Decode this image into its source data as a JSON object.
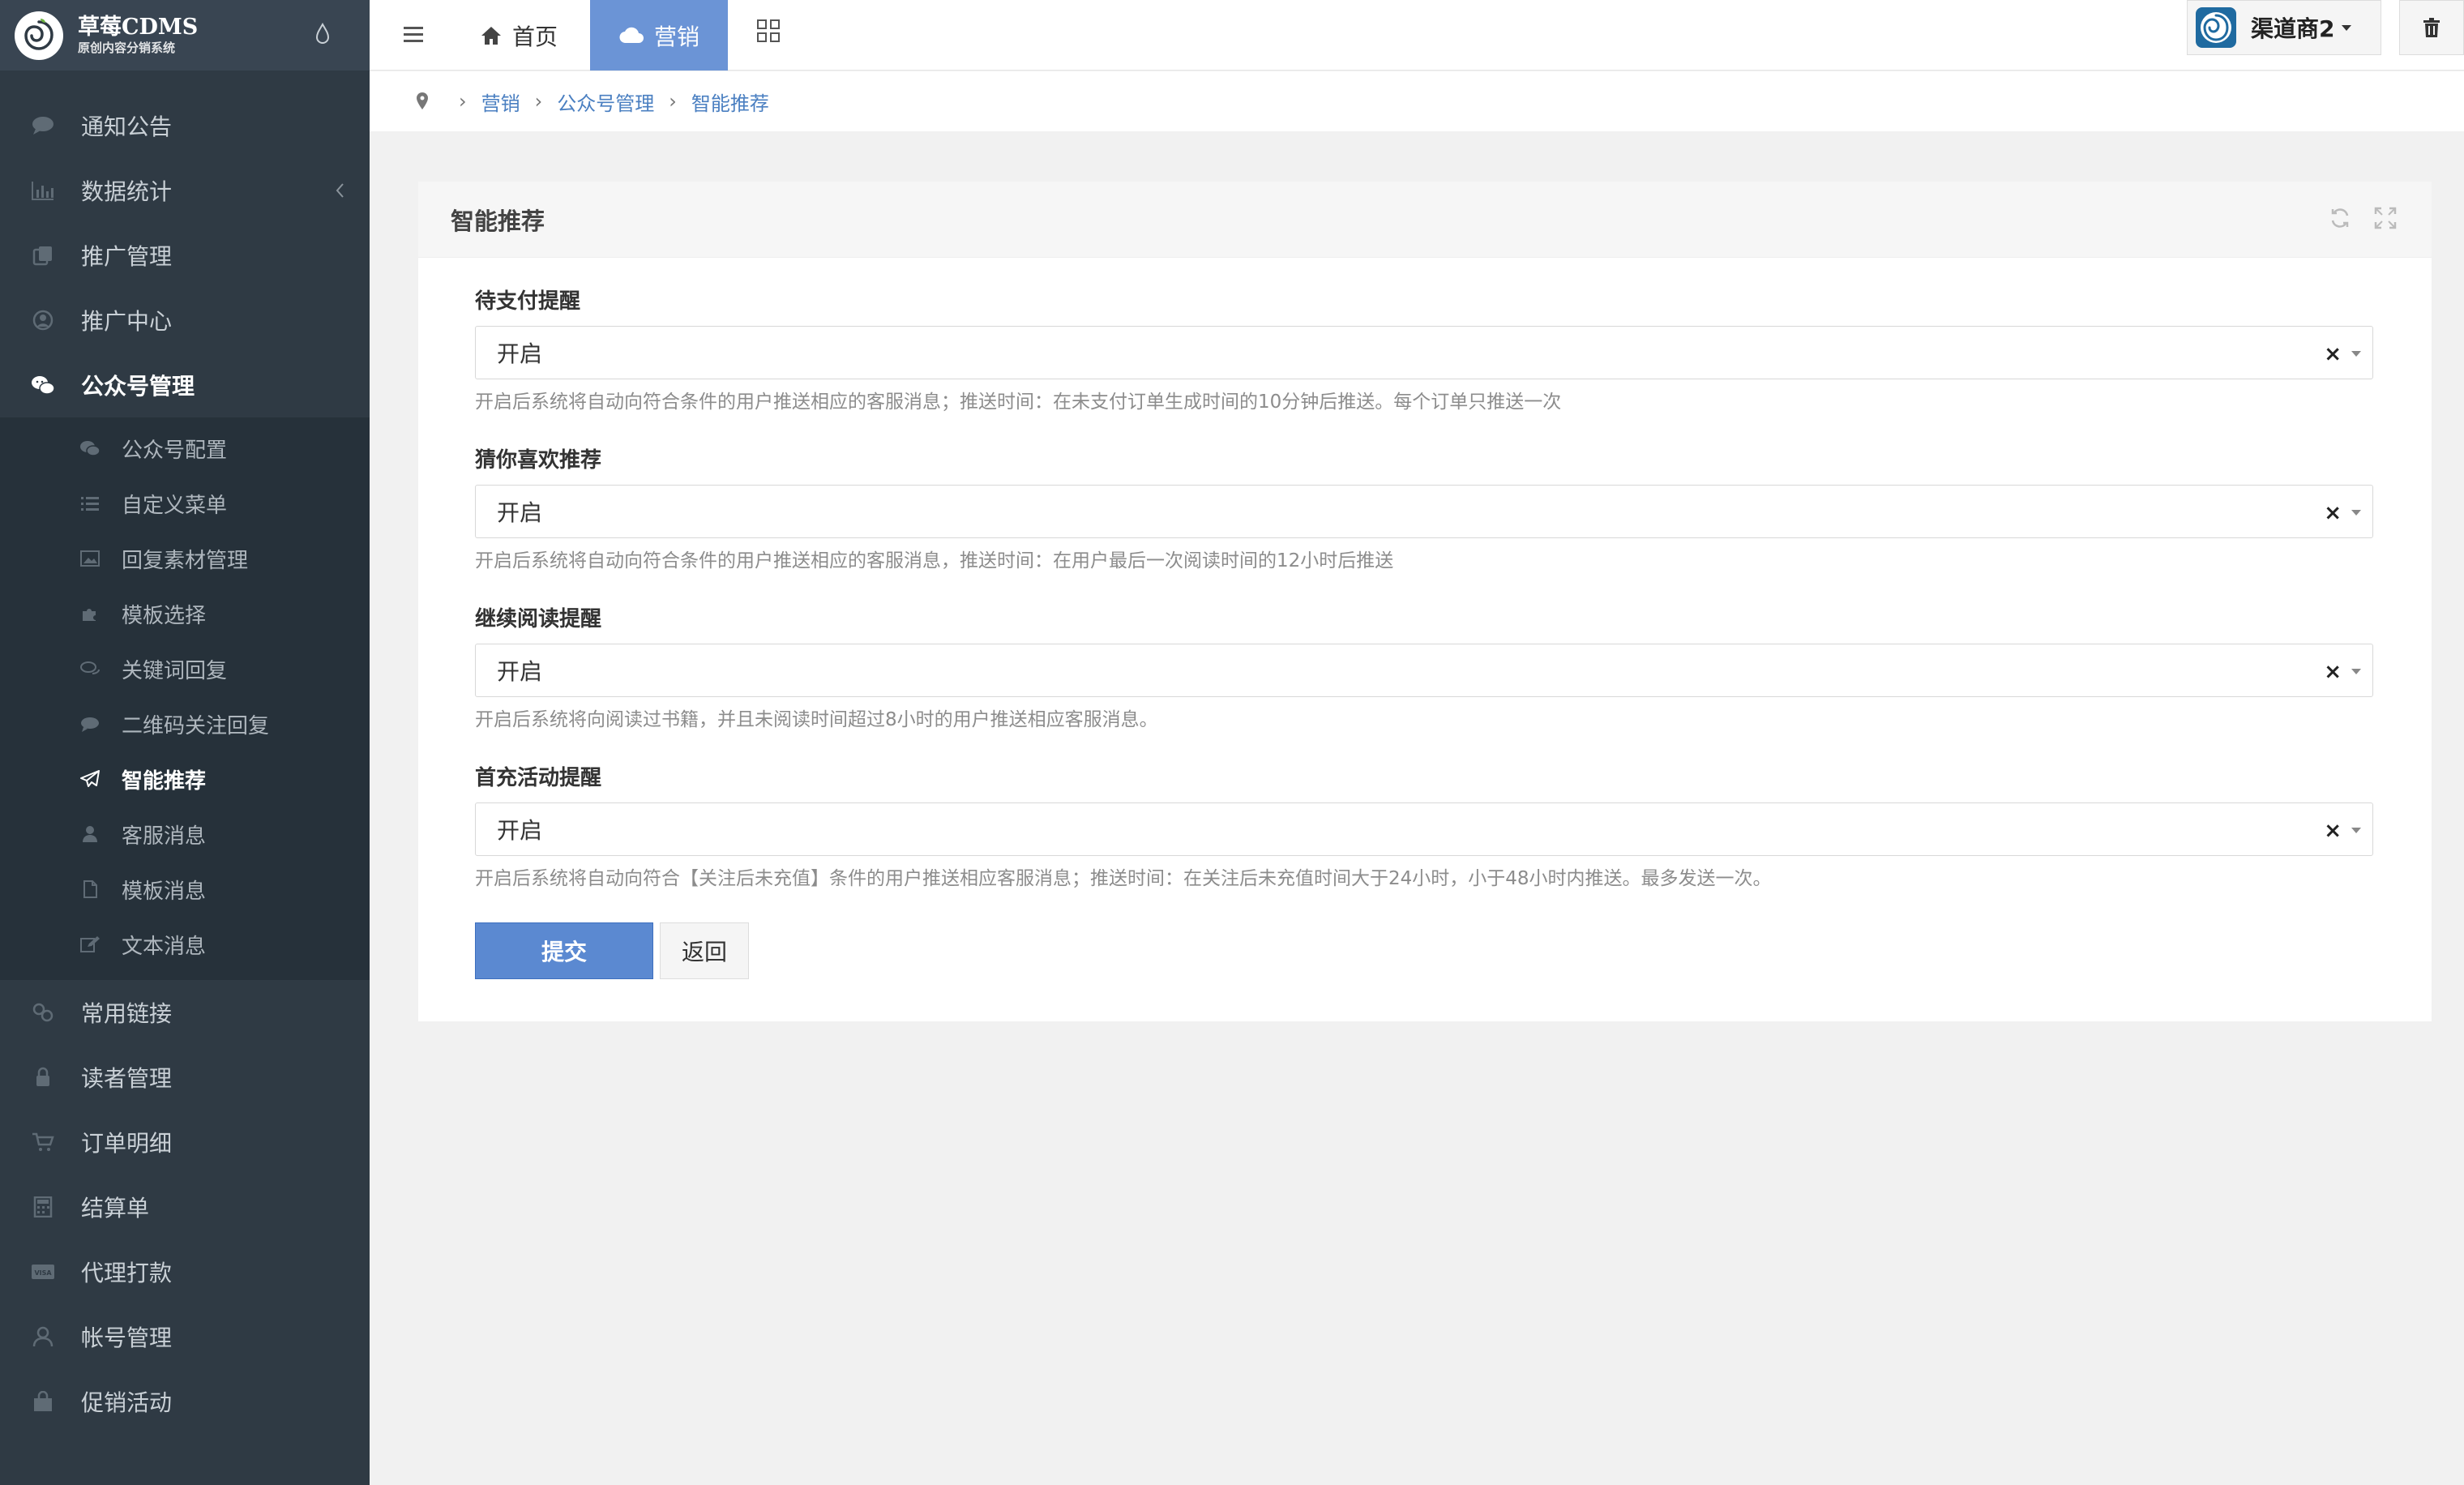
{
  "brand": {
    "name": "草莓CDMS",
    "subtitle": "原创内容分销系统"
  },
  "sidebar": {
    "items": [
      {
        "label": "通知公告",
        "icon": "comment-icon"
      },
      {
        "label": "数据统计",
        "icon": "bar-chart-icon"
      },
      {
        "label": "推广管理",
        "icon": "copy-icon"
      },
      {
        "label": "推广中心",
        "icon": "user-badge-icon"
      },
      {
        "label": "公众号管理",
        "icon": "wechat-icon"
      },
      {
        "label": "常用链接",
        "icon": "link-icon"
      },
      {
        "label": "读者管理",
        "icon": "lock-icon"
      },
      {
        "label": "订单明细",
        "icon": "cart-icon"
      },
      {
        "label": "结算单",
        "icon": "calculator-icon"
      },
      {
        "label": "代理打款",
        "icon": "visa-icon"
      },
      {
        "label": "帐号管理",
        "icon": "user-icon"
      },
      {
        "label": "促销活动",
        "icon": "bag-icon"
      }
    ],
    "submenu": [
      {
        "label": "公众号配置",
        "icon": "wechat-icon"
      },
      {
        "label": "自定义菜单",
        "icon": "list-icon"
      },
      {
        "label": "回复素材管理",
        "icon": "image-icon"
      },
      {
        "label": "模板选择",
        "icon": "puzzle-icon"
      },
      {
        "label": "关键词回复",
        "icon": "comments-icon"
      },
      {
        "label": "二维码关注回复",
        "icon": "comment-icon"
      },
      {
        "label": "智能推荐",
        "icon": "paper-plane-icon"
      },
      {
        "label": "客服消息",
        "icon": "user-icon"
      },
      {
        "label": "模板消息",
        "icon": "file-icon"
      },
      {
        "label": "文本消息",
        "icon": "edit-icon"
      }
    ]
  },
  "topbar": {
    "home": "首页",
    "marketing": "营销",
    "user": "渠道商2"
  },
  "breadcrumb": [
    "营销",
    "公众号管理",
    "智能推荐"
  ],
  "panel": {
    "title": "智能推荐",
    "fields": [
      {
        "label": "待支付提醒",
        "value": "开启",
        "help": "开启后系统将自动向符合条件的用户推送相应的客服消息；推送时间：在未支付订单生成时间的10分钟后推送。每个订单只推送一次"
      },
      {
        "label": "猜你喜欢推荐",
        "value": "开启",
        "help": "开启后系统将自动向符合条件的用户推送相应的客服消息，推送时间：在用户最后一次阅读时间的12小时后推送"
      },
      {
        "label": "继续阅读提醒",
        "value": "开启",
        "help": "开启后系统将向阅读过书籍，并且未阅读时间超过8小时的用户推送相应客服消息。"
      },
      {
        "label": "首充活动提醒",
        "value": "开启",
        "help": "开启后系统将自动向符合【关注后未充值】条件的用户推送相应客服消息；推送时间：在关注后未充值时间大于24小时，小于48小时内推送。最多发送一次。"
      }
    ],
    "clear_symbol": "×",
    "submit": "提交",
    "back": "返回"
  },
  "colors": {
    "sidebar_bg": "#2f3a44",
    "accent": "#6b94d6",
    "link": "#4a7fc1"
  }
}
